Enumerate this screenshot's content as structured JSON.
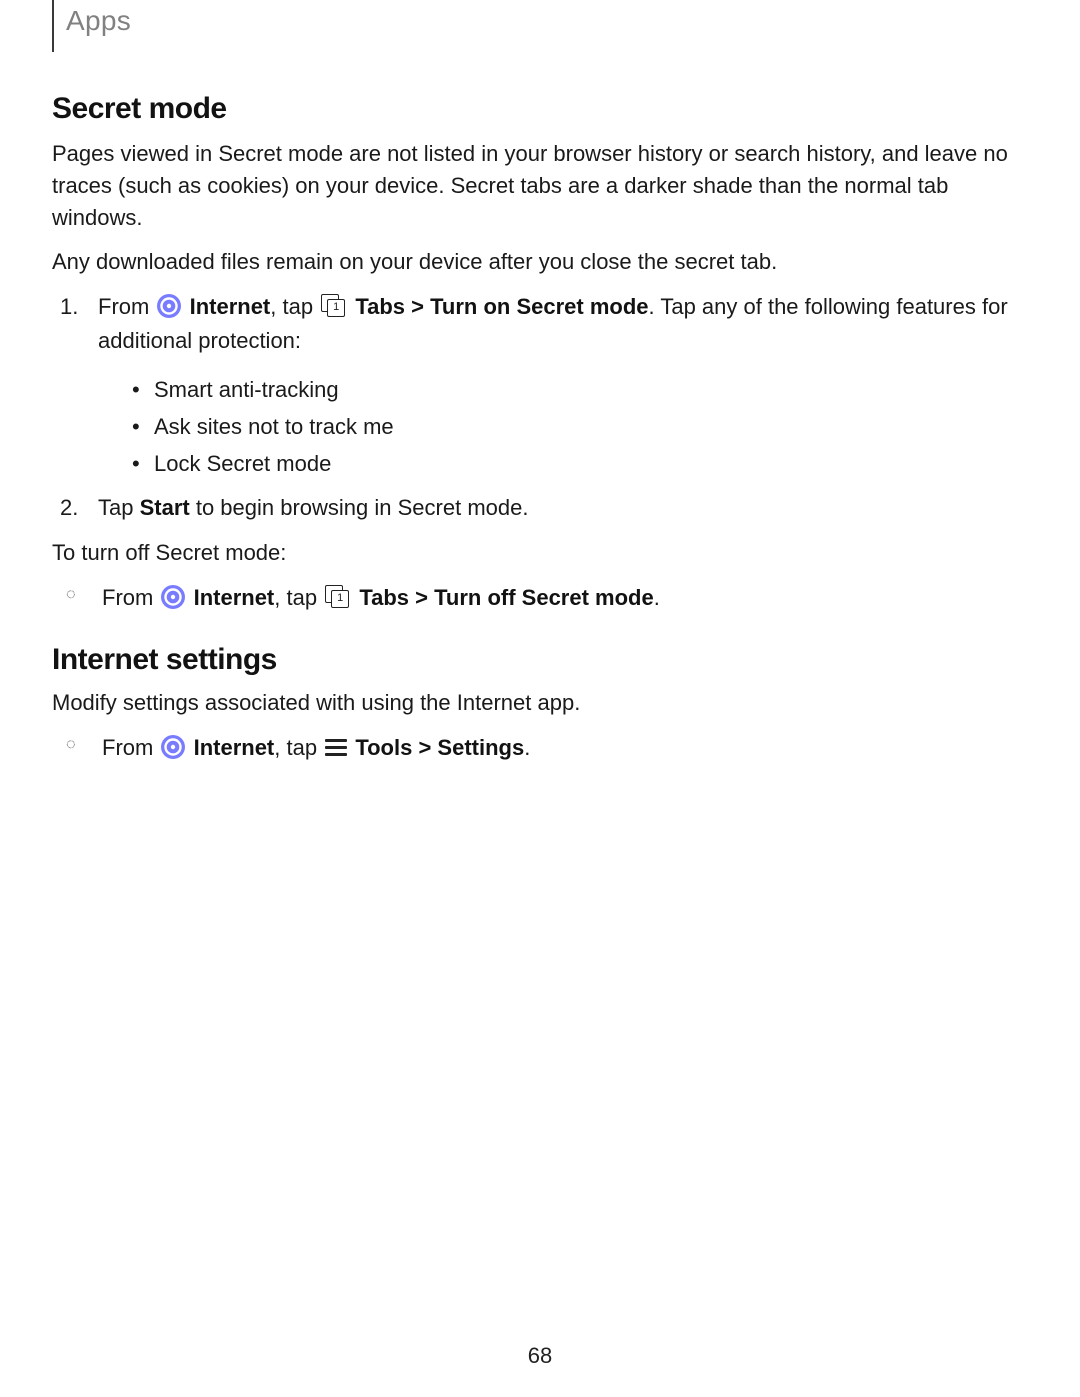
{
  "header": {
    "section": "Apps"
  },
  "s1": {
    "title": "Secret mode",
    "p1": "Pages viewed in Secret mode are not listed in your browser history or search history, and leave no traces (such as cookies) on your device. Secret tabs are a darker shade than the normal tab windows.",
    "p2": "Any downloaded files remain on your device after you close the secret tab.",
    "step1_pre": "From ",
    "step1_app": "Internet",
    "step1_mid": ", tap ",
    "step1_path": "Tabs > Turn on Secret mode",
    "step1_post": ". Tap any of the following features for additional protection:",
    "features": {
      "a": "Smart anti-tracking",
      "b": "Ask sites not to track me",
      "c": "Lock Secret mode"
    },
    "step2_pre": "Tap ",
    "step2_action": "Start",
    "step2_post": " to begin browsing in Secret mode.",
    "off_intro": "To turn off Secret mode:",
    "off_pre": "From ",
    "off_app": "Internet",
    "off_mid": ", tap ",
    "off_path": "Tabs > Turn off Secret mode",
    "off_post": "."
  },
  "s2": {
    "title": "Internet settings",
    "p1": "Modify settings associated with using the Internet app.",
    "step_pre": "From ",
    "step_app": "Internet",
    "step_mid": ", tap ",
    "step_path": "Tools > Settings",
    "step_post": "."
  },
  "icons": {
    "tabs_badge": "1"
  },
  "page_number": "68"
}
